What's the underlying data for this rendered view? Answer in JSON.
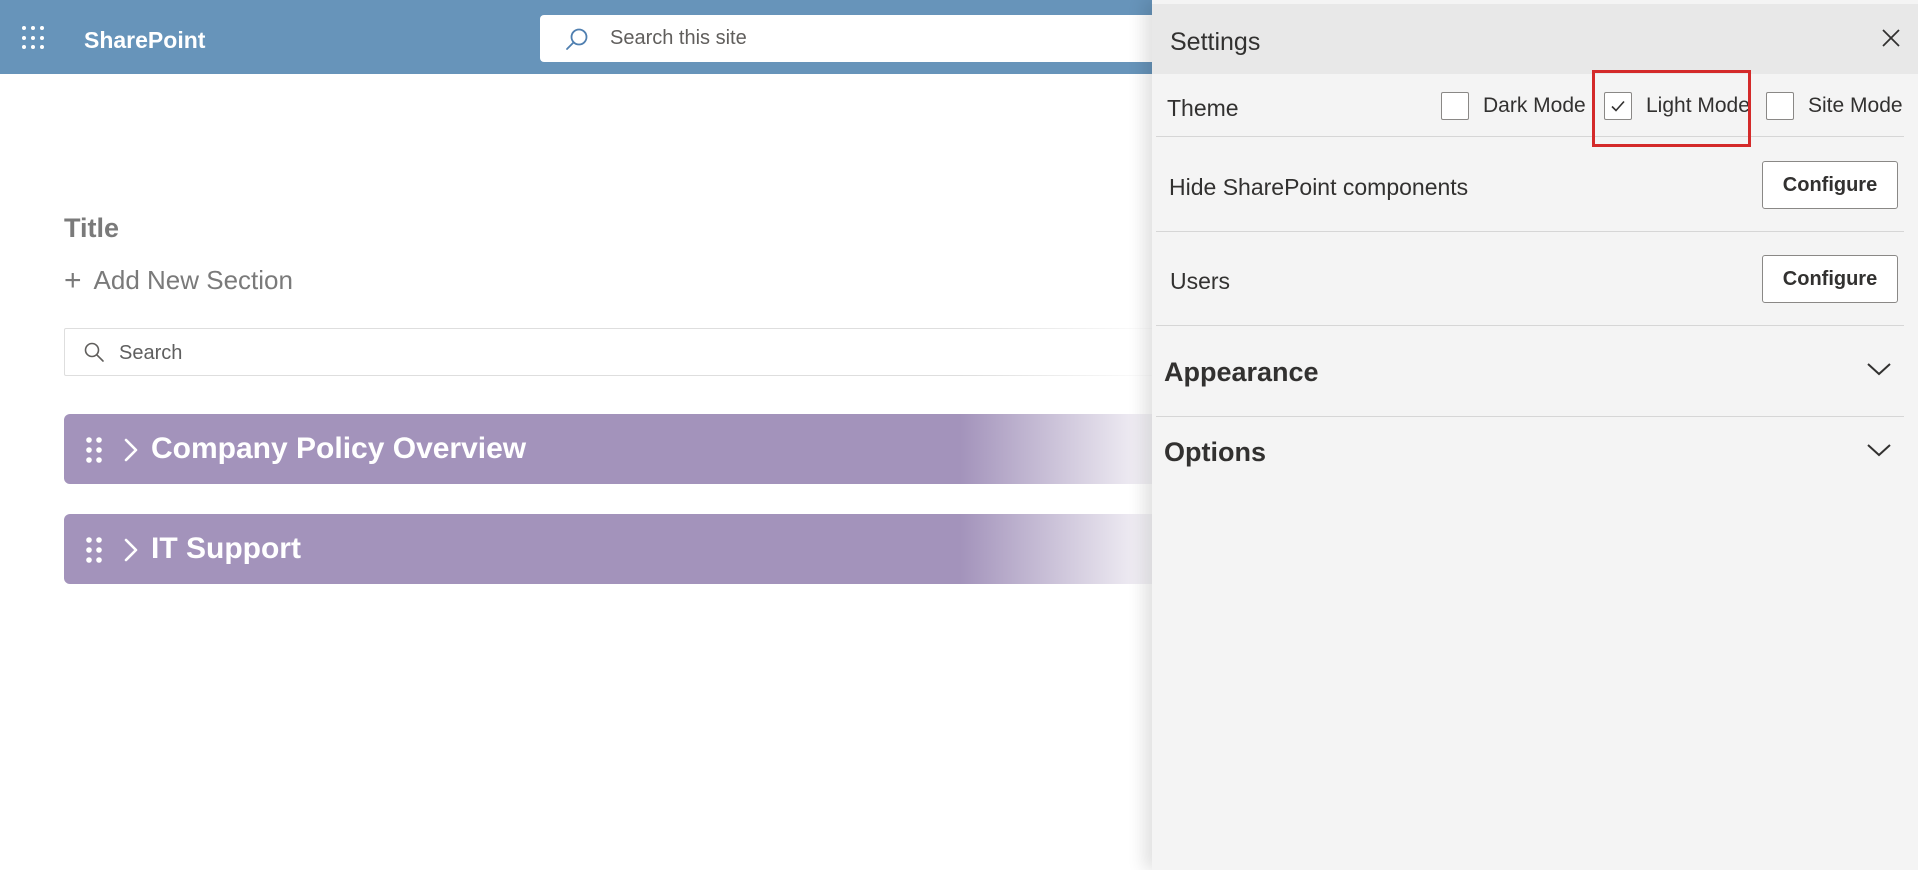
{
  "header": {
    "app_name": "SharePoint",
    "search_placeholder": "Search this site",
    "background_color": "#6794ba"
  },
  "page": {
    "title": "Title",
    "add_section": {
      "icon": "plus-icon",
      "label": "Add New Section"
    },
    "search_placeholder": "Search",
    "sections": [
      {
        "label": "Company Policy Overview",
        "expanded": false
      },
      {
        "label": "IT Support",
        "expanded": false
      }
    ],
    "section_color": "#a393bb"
  },
  "settings": {
    "title": "Settings",
    "theme": {
      "label": "Theme",
      "options": [
        {
          "label": "Dark Mode",
          "checked": false
        },
        {
          "label": "Light Mode",
          "checked": true
        },
        {
          "label": "Site Mode",
          "checked": false
        }
      ]
    },
    "rows": [
      {
        "label": "Hide SharePoint components",
        "button": "Configure"
      },
      {
        "label": "Users",
        "button": "Configure"
      }
    ],
    "accordions": [
      {
        "label": "Appearance",
        "expanded": false
      },
      {
        "label": "Options",
        "expanded": false
      }
    ],
    "highlight_color": "#d42a2a"
  }
}
